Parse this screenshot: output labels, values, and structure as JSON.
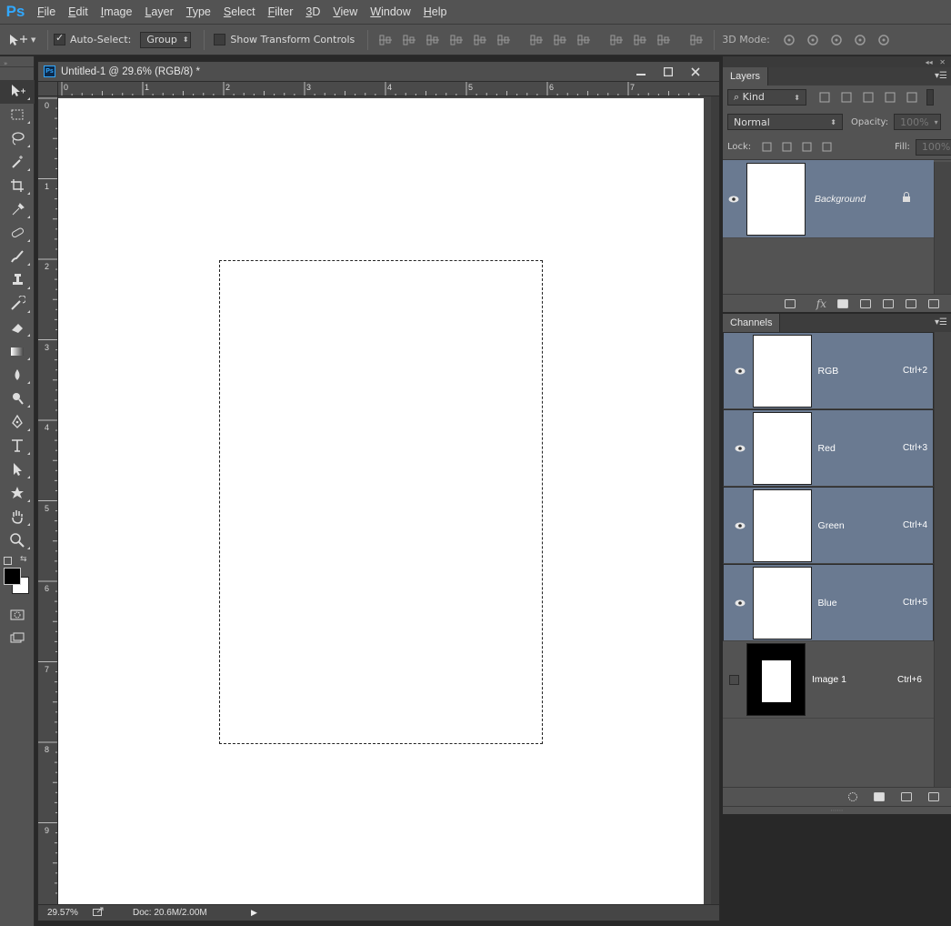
{
  "app": {
    "logo": "Ps"
  },
  "menu": [
    {
      "label": "File",
      "ul": "F",
      "rest": "ile"
    },
    {
      "label": "Edit",
      "ul": "E",
      "rest": "dit"
    },
    {
      "label": "Image",
      "ul": "I",
      "rest": "mage"
    },
    {
      "label": "Layer",
      "ul": "L",
      "rest": "ayer"
    },
    {
      "label": "Type",
      "ul": "Y",
      "rest": "pe"
    },
    {
      "label": "Select",
      "ul": "S",
      "rest": "elect"
    },
    {
      "label": "Filter",
      "ul": "T",
      "rest": "ilter"
    },
    {
      "label": "3D",
      "ul": "3",
      "rest": "D"
    },
    {
      "label": "View",
      "ul": "V",
      "rest": "iew"
    },
    {
      "label": "Window",
      "ul": "W",
      "rest": "indow"
    },
    {
      "label": "Help",
      "ul": "H",
      "rest": "elp"
    }
  ],
  "options": {
    "auto_select_label": "Auto-Select:",
    "auto_select_checked": true,
    "auto_select_value": "Group",
    "show_transform_label": "Show Transform Controls",
    "show_transform_checked": false,
    "mode3d_label": "3D Mode:"
  },
  "document": {
    "title": "Untitled-1 @ 29.6% (RGB/8) *",
    "zoom": "29.57%",
    "doc_info": "Doc: 20.6M/2.00M",
    "ruler_top": [
      "0",
      "1",
      "2",
      "3",
      "4",
      "5",
      "6",
      "7"
    ],
    "ruler_left": [
      "0",
      "1",
      "2",
      "3",
      "4",
      "5",
      "6",
      "7",
      "8",
      "9"
    ]
  },
  "layers_panel": {
    "tab": "Layers",
    "filter_kind": "Kind",
    "blend_mode": "Normal",
    "opacity_label": "Opacity:",
    "opacity_value": "100%",
    "lock_label": "Lock:",
    "fill_label": "Fill:",
    "fill_value": "100%",
    "layers": [
      {
        "name": "Background",
        "locked": true
      }
    ]
  },
  "channels_panel": {
    "tab": "Channels",
    "channels": [
      {
        "name": "RGB",
        "shortcut": "Ctrl+2",
        "visible": true,
        "selected": true
      },
      {
        "name": "Red",
        "shortcut": "Ctrl+3",
        "visible": true,
        "selected": true
      },
      {
        "name": "Green",
        "shortcut": "Ctrl+4",
        "visible": true,
        "selected": true
      },
      {
        "name": "Blue",
        "shortcut": "Ctrl+5",
        "visible": true,
        "selected": true
      },
      {
        "name": "Image 1",
        "shortcut": "Ctrl+6",
        "visible": false,
        "selected": false
      }
    ]
  },
  "colors": {
    "selected_row": "#6a7a91",
    "panel_bg": "#535353",
    "logo": "#31a8ff"
  }
}
